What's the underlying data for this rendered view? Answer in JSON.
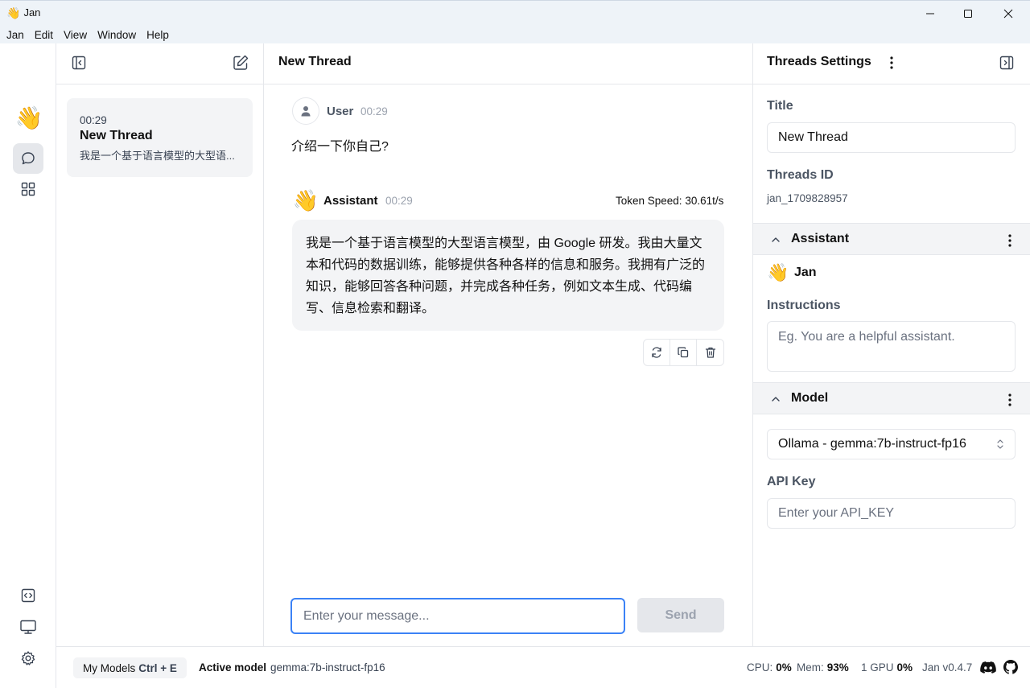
{
  "window": {
    "app_icon": "waving-hand-emoji",
    "title": "Jan",
    "controls": [
      "minimize-icon",
      "maximize-icon",
      "close-icon"
    ]
  },
  "menu": [
    "Jan",
    "Edit",
    "View",
    "Window",
    "Help"
  ],
  "rail": {
    "logo": "waving-hand-emoji",
    "top_icons": [
      "chat-icon",
      "grid-icon"
    ],
    "bottom_icons": [
      "code-icon",
      "monitor-icon",
      "gear-icon"
    ]
  },
  "threads": {
    "items": [
      {
        "time": "00:29",
        "title": "New Thread",
        "preview": "我是一个基于语言模型的大型语..."
      }
    ]
  },
  "main": {
    "title": "New Thread",
    "messages": {
      "user": {
        "name": "User",
        "time": "00:29",
        "text": "介绍一下你自己?"
      },
      "assistant": {
        "name": "Assistant",
        "time": "00:29",
        "token_speed": "Token Speed: 30.61t/s",
        "lines": [
          "我是一个基于语言模型的大型语言模型，由 Google 研发。我由大量文",
          "本和代码的数据训练，能够提供各种各样的信息和服务。我拥有广泛的",
          "知识，能够回答各种问题，并完成各种任务，例如文本生成、代码编",
          "写、信息检索和翻译。"
        ]
      }
    },
    "input_placeholder": "Enter your message...",
    "send_label": "Send"
  },
  "settings": {
    "header": "Threads Settings",
    "title_label": "Title",
    "title_value": "New Thread",
    "id_label": "Threads ID",
    "id_value": "jan_1709828957",
    "assistant_section": "Assistant",
    "assistant_name": "Jan",
    "instructions_label": "Instructions",
    "instructions_placeholder": "Eg. You are a helpful assistant.",
    "model_section": "Model",
    "model_value": "Ollama - gemma:7b-instruct-fp16",
    "api_key_label": "API Key",
    "api_key_placeholder": "Enter your API_KEY"
  },
  "status": {
    "my_models": "My Models",
    "shortcut": "Ctrl + E",
    "active_label": "Active model",
    "active_value": "gemma:7b-instruct-fp16",
    "cpu_label": "CPU:",
    "cpu_value": "0%",
    "mem_label": "Mem:",
    "mem_value": "93%",
    "gpu_label": "1 GPU",
    "gpu_value": "0%",
    "version": "Jan v0.4.7"
  }
}
